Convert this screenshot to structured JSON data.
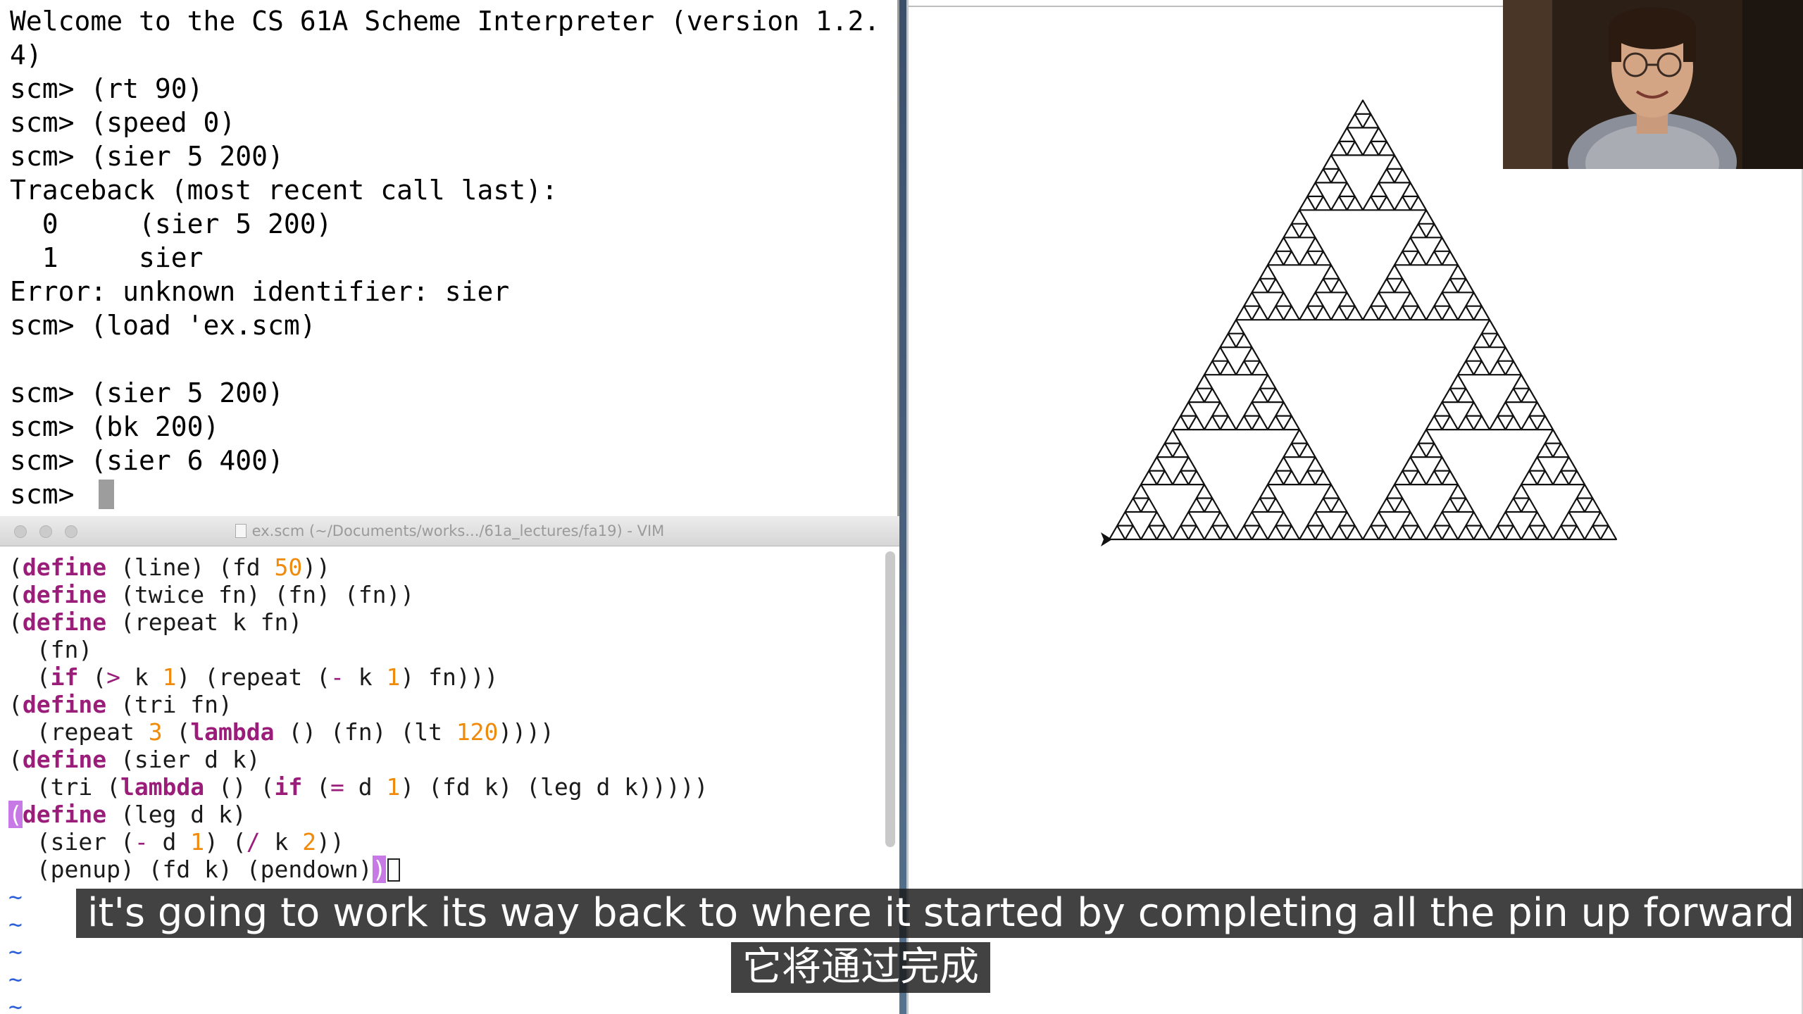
{
  "terminal": {
    "lines": [
      "Welcome to the CS 61A Scheme Interpreter (version 1.2.",
      "4)",
      "scm> (rt 90)",
      "scm> (speed 0)",
      "scm> (sier 5 200)",
      "Traceback (most recent call last):",
      "  0     (sier 5 200)",
      "  1     sier",
      "Error: unknown identifier: sier",
      "scm> (load 'ex.scm)",
      "",
      "scm> (sier 5 200)",
      "scm> (bk 200)",
      "scm> (sier 6 400)"
    ],
    "prompt": "scm> "
  },
  "vim": {
    "title": "ex.scm (~/Documents/works.../61a_lectures/fa19) - VIM",
    "code_lines": [
      [
        {
          "t": "(",
          "c": ""
        },
        {
          "t": "define",
          "c": "kw"
        },
        {
          "t": " (line) (fd ",
          "c": ""
        },
        {
          "t": "50",
          "c": "num"
        },
        {
          "t": "))",
          "c": ""
        }
      ],
      [
        {
          "t": "(",
          "c": ""
        },
        {
          "t": "define",
          "c": "kw"
        },
        {
          "t": " (twice fn) (fn) (fn))",
          "c": ""
        }
      ],
      [
        {
          "t": "(",
          "c": ""
        },
        {
          "t": "define",
          "c": "kw"
        },
        {
          "t": " (repeat k fn)",
          "c": ""
        }
      ],
      [
        {
          "t": "  (fn)",
          "c": ""
        }
      ],
      [
        {
          "t": "  (",
          "c": ""
        },
        {
          "t": "if",
          "c": "kw"
        },
        {
          "t": " (",
          "c": ""
        },
        {
          "t": ">",
          "c": "op"
        },
        {
          "t": " k ",
          "c": ""
        },
        {
          "t": "1",
          "c": "num"
        },
        {
          "t": ") (repeat (",
          "c": ""
        },
        {
          "t": "-",
          "c": "op"
        },
        {
          "t": " k ",
          "c": ""
        },
        {
          "t": "1",
          "c": "num"
        },
        {
          "t": ") fn)))",
          "c": ""
        }
      ],
      [
        {
          "t": "(",
          "c": ""
        },
        {
          "t": "define",
          "c": "kw"
        },
        {
          "t": " (tri fn)",
          "c": ""
        }
      ],
      [
        {
          "t": "  (repeat ",
          "c": ""
        },
        {
          "t": "3",
          "c": "num"
        },
        {
          "t": " (",
          "c": ""
        },
        {
          "t": "lambda",
          "c": "kw"
        },
        {
          "t": " () (fn) (lt ",
          "c": ""
        },
        {
          "t": "120",
          "c": "num"
        },
        {
          "t": "))))",
          "c": ""
        }
      ],
      [
        {
          "t": "(",
          "c": ""
        },
        {
          "t": "define",
          "c": "kw"
        },
        {
          "t": " (sier d k)",
          "c": ""
        }
      ],
      [
        {
          "t": "  (tri (",
          "c": ""
        },
        {
          "t": "lambda",
          "c": "kw"
        },
        {
          "t": " () (",
          "c": ""
        },
        {
          "t": "if",
          "c": "kw"
        },
        {
          "t": " (",
          "c": ""
        },
        {
          "t": "=",
          "c": "op"
        },
        {
          "t": " d ",
          "c": ""
        },
        {
          "t": "1",
          "c": "num"
        },
        {
          "t": ") (fd k) (leg d k)))))",
          "c": ""
        }
      ],
      [
        {
          "t": "(",
          "c": "hl-paren"
        },
        {
          "t": "define",
          "c": "kw"
        },
        {
          "t": " (leg d k)",
          "c": ""
        }
      ],
      [
        {
          "t": "  (sier (",
          "c": ""
        },
        {
          "t": "-",
          "c": "op"
        },
        {
          "t": " d ",
          "c": ""
        },
        {
          "t": "1",
          "c": "num"
        },
        {
          "t": ") (",
          "c": ""
        },
        {
          "t": "/",
          "c": "op"
        },
        {
          "t": " k ",
          "c": ""
        },
        {
          "t": "2",
          "c": "num"
        },
        {
          "t": "))",
          "c": ""
        }
      ],
      [
        {
          "t": "  (penup) (fd k) (pendown)",
          "c": ""
        },
        {
          "t": ")",
          "c": "hl-paren"
        }
      ]
    ],
    "tildes": [
      "~",
      "~",
      "~",
      "~",
      "~"
    ]
  },
  "canvas": {
    "fractal_depth": 6,
    "stroke_color": "#111111"
  },
  "subtitles": {
    "english": "it's going to work its way back to where it started by completing all the pin up forward",
    "chinese": "它将通过完成"
  }
}
